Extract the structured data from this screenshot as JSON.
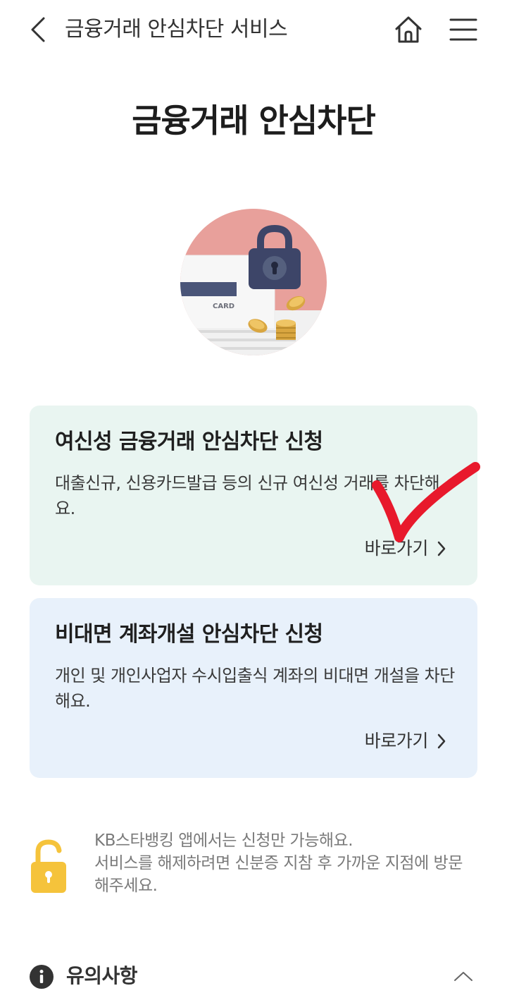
{
  "header": {
    "title": "금융거래 안심차단 서비스",
    "back_icon": "chevron-left-icon",
    "home_icon": "home-icon",
    "menu_icon": "hamburger-menu-icon"
  },
  "page": {
    "title": "금융거래 안심차단"
  },
  "hero": {
    "card_text": "CARD"
  },
  "cards": [
    {
      "title": "여신성 금융거래 안심차단 신청",
      "description": "대출신규, 신용카드발급 등의 신규 여신성 거래를 차단해요.",
      "link_label": "바로가기",
      "background": "#e9f5f1"
    },
    {
      "title": "비대면 계좌개설 안심차단 신청",
      "description": "개인 및 개인사업자 수시입출식 계좌의 비대면 개설을 차단해요.",
      "link_label": "바로가기",
      "background": "#e8f1fb"
    }
  ],
  "notice": {
    "line1": "KB스타뱅킹 앱에서는 신청만 가능해요.",
    "line2": "서비스를 해제하려면 신분증 지참 후 가까운 지점에 방문해주세요.",
    "icon": "unlocked-padlock-icon",
    "icon_color": "#f5c33b"
  },
  "caution": {
    "label": "유의사항",
    "icon": "info-icon",
    "toggle_icon": "chevron-up-icon"
  },
  "annotation": {
    "color": "#e8192c"
  }
}
